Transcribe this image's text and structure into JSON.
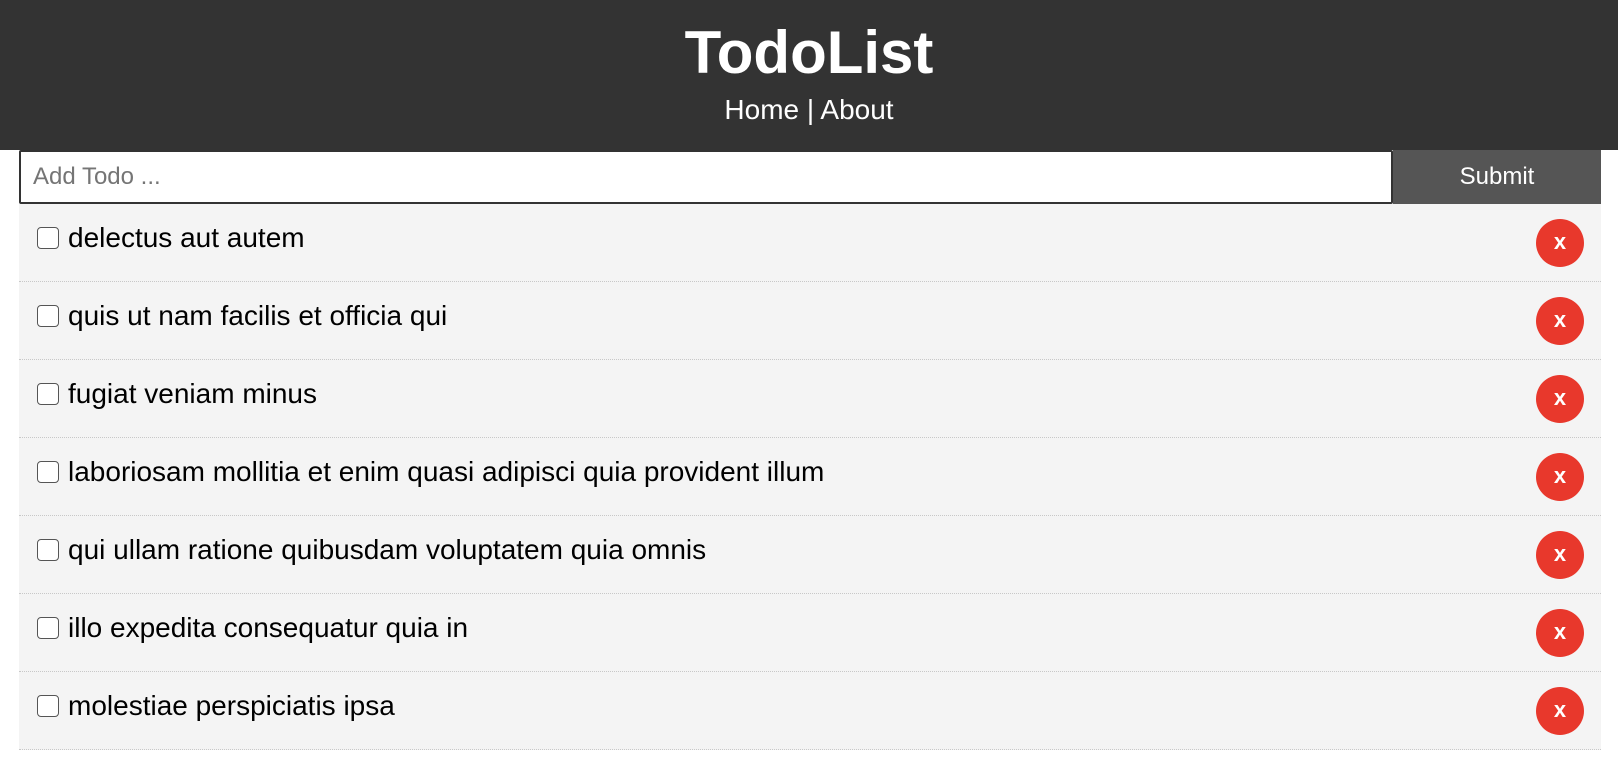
{
  "header": {
    "title": "TodoList",
    "nav": {
      "home": "Home",
      "separator": "|",
      "about": "About"
    }
  },
  "form": {
    "placeholder": "Add Todo ...",
    "value": "",
    "submit_label": "Submit"
  },
  "todos": [
    {
      "title": "delectus aut autem",
      "completed": false,
      "delete_label": "x"
    },
    {
      "title": "quis ut nam facilis et officia qui",
      "completed": false,
      "delete_label": "x"
    },
    {
      "title": "fugiat veniam minus",
      "completed": false,
      "delete_label": "x"
    },
    {
      "title": "laboriosam mollitia et enim quasi adipisci quia provident illum",
      "completed": false,
      "delete_label": "x"
    },
    {
      "title": "qui ullam ratione quibusdam voluptatem quia omnis",
      "completed": false,
      "delete_label": "x"
    },
    {
      "title": "illo expedita consequatur quia in",
      "completed": false,
      "delete_label": "x"
    },
    {
      "title": "molestiae perspiciatis ipsa",
      "completed": false,
      "delete_label": "x"
    }
  ],
  "colors": {
    "header_bg": "#333333",
    "submit_bg": "#555555",
    "item_bg": "#f4f4f4",
    "delete_bg": "#e8382c"
  }
}
